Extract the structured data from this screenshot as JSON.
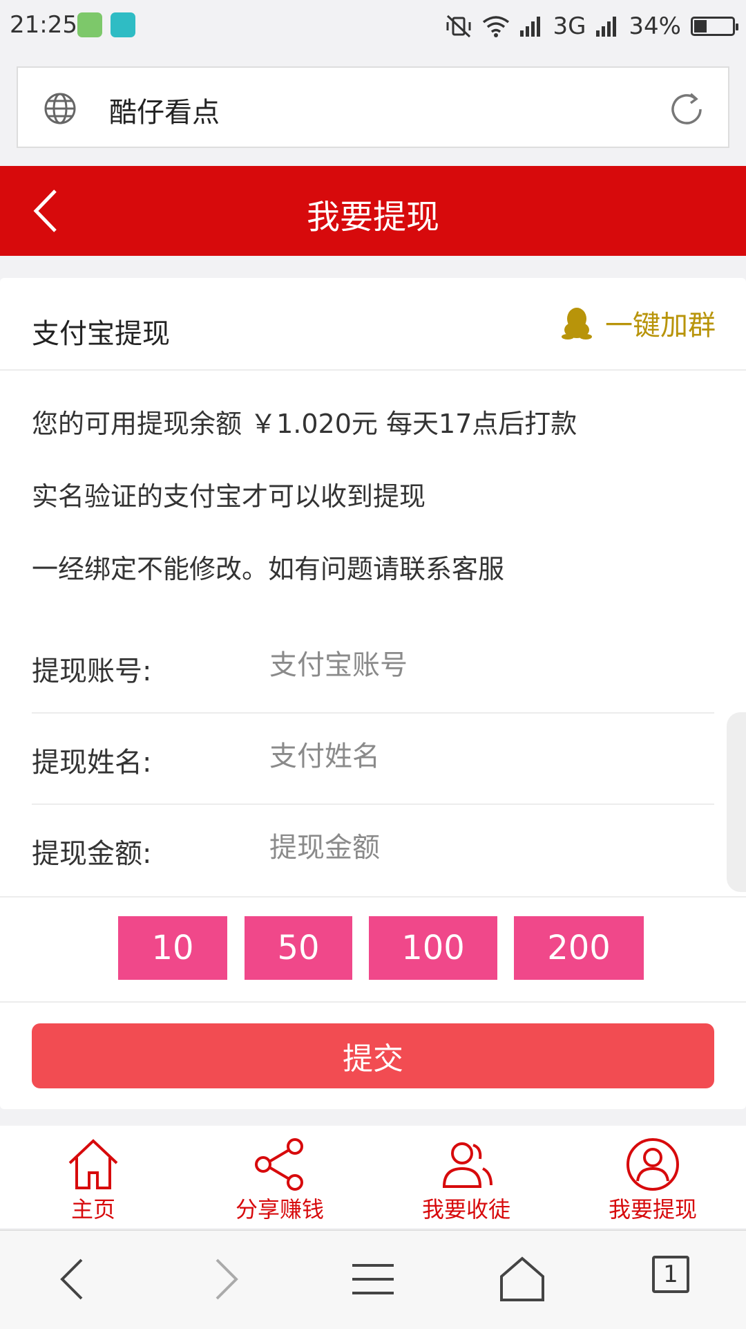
{
  "status_bar": {
    "time": "21:25",
    "network": "3G",
    "battery": "34%",
    "battery_level": 0.34
  },
  "address_bar": {
    "site_name": "酷仔看点"
  },
  "header": {
    "title": "我要提现"
  },
  "card": {
    "title": "支付宝提现",
    "join_group": "一键加群",
    "info_lines": [
      "您的可用提现余额 ￥1.020元 每天17点后打款",
      "实名验证的支付宝才可以收到提现",
      "一经绑定不能修改。如有问题请联系客服"
    ],
    "form": {
      "account": {
        "label": "提现账号:",
        "placeholder": "支付宝账号"
      },
      "name": {
        "label": "提现姓名:",
        "placeholder": "支付姓名"
      },
      "amount": {
        "label": "提现金额:",
        "placeholder": "提现金额"
      }
    },
    "amount_options": [
      "10",
      "50",
      "100",
      "200"
    ],
    "submit_label": "提交"
  },
  "bottom_nav": [
    {
      "label": "主页",
      "icon": "home-icon"
    },
    {
      "label": "分享赚钱",
      "icon": "share-icon"
    },
    {
      "label": "我要收徒",
      "icon": "users-icon"
    },
    {
      "label": "我要提现",
      "icon": "user-circle-icon"
    }
  ],
  "browser_bar": {
    "tab_count": "1"
  },
  "colors": {
    "brand_red": "#d70a0c",
    "amount_pink": "#f0488a",
    "submit_red": "#f24c52",
    "gold": "#b8940a"
  }
}
